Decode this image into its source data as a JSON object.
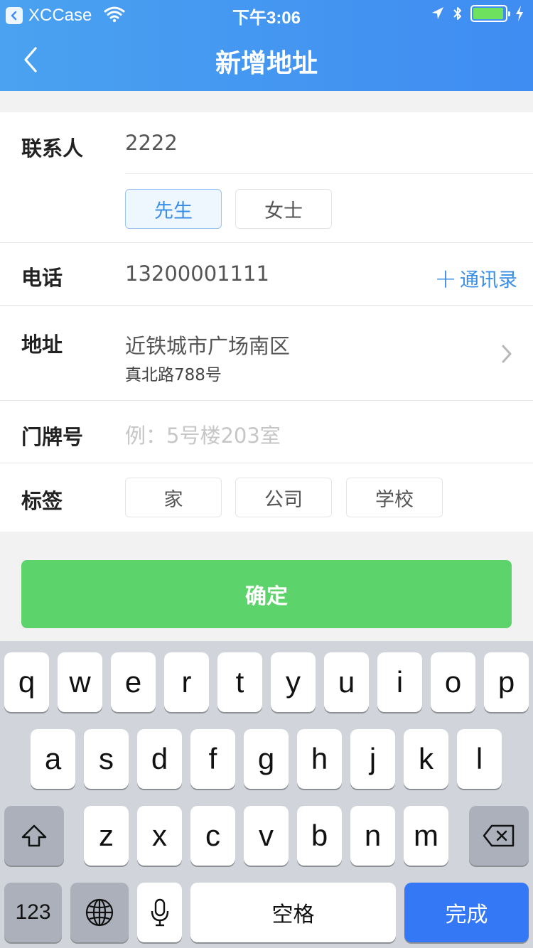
{
  "status_bar": {
    "back_app": "XCCase",
    "time": "下午3:06",
    "battery_level": 0.95
  },
  "nav": {
    "title": "新增地址"
  },
  "form": {
    "contact": {
      "label": "联系人",
      "value": "2222",
      "genders": [
        {
          "label": "先生",
          "selected": true
        },
        {
          "label": "女士",
          "selected": false
        }
      ]
    },
    "phone": {
      "label": "电话",
      "value": "13200001111",
      "contacts_plus": "+",
      "contacts_link": "通讯录"
    },
    "address": {
      "label": "地址",
      "line1": "近铁城市广场南区",
      "line2": "真北路788号"
    },
    "door": {
      "label": "门牌号",
      "placeholder": "例：5号楼203室"
    },
    "tags": {
      "label": "标签",
      "items": [
        "家",
        "公司",
        "学校"
      ]
    }
  },
  "confirm_label": "确定",
  "keyboard": {
    "row1": [
      "q",
      "w",
      "e",
      "r",
      "t",
      "y",
      "u",
      "i",
      "o",
      "p"
    ],
    "row2": [
      "a",
      "s",
      "d",
      "f",
      "g",
      "h",
      "j",
      "k",
      "l"
    ],
    "row3": [
      "z",
      "x",
      "c",
      "v",
      "b",
      "n",
      "m"
    ],
    "numbers_key": "123",
    "space_key": "空格",
    "done_key": "完成"
  },
  "colors": {
    "nav_gradient_start": "#4aa2f0",
    "nav_gradient_end": "#3f8cf2",
    "accent_blue": "#3b8ee6",
    "confirm_green": "#5dd36c",
    "done_blue": "#3478f6"
  }
}
